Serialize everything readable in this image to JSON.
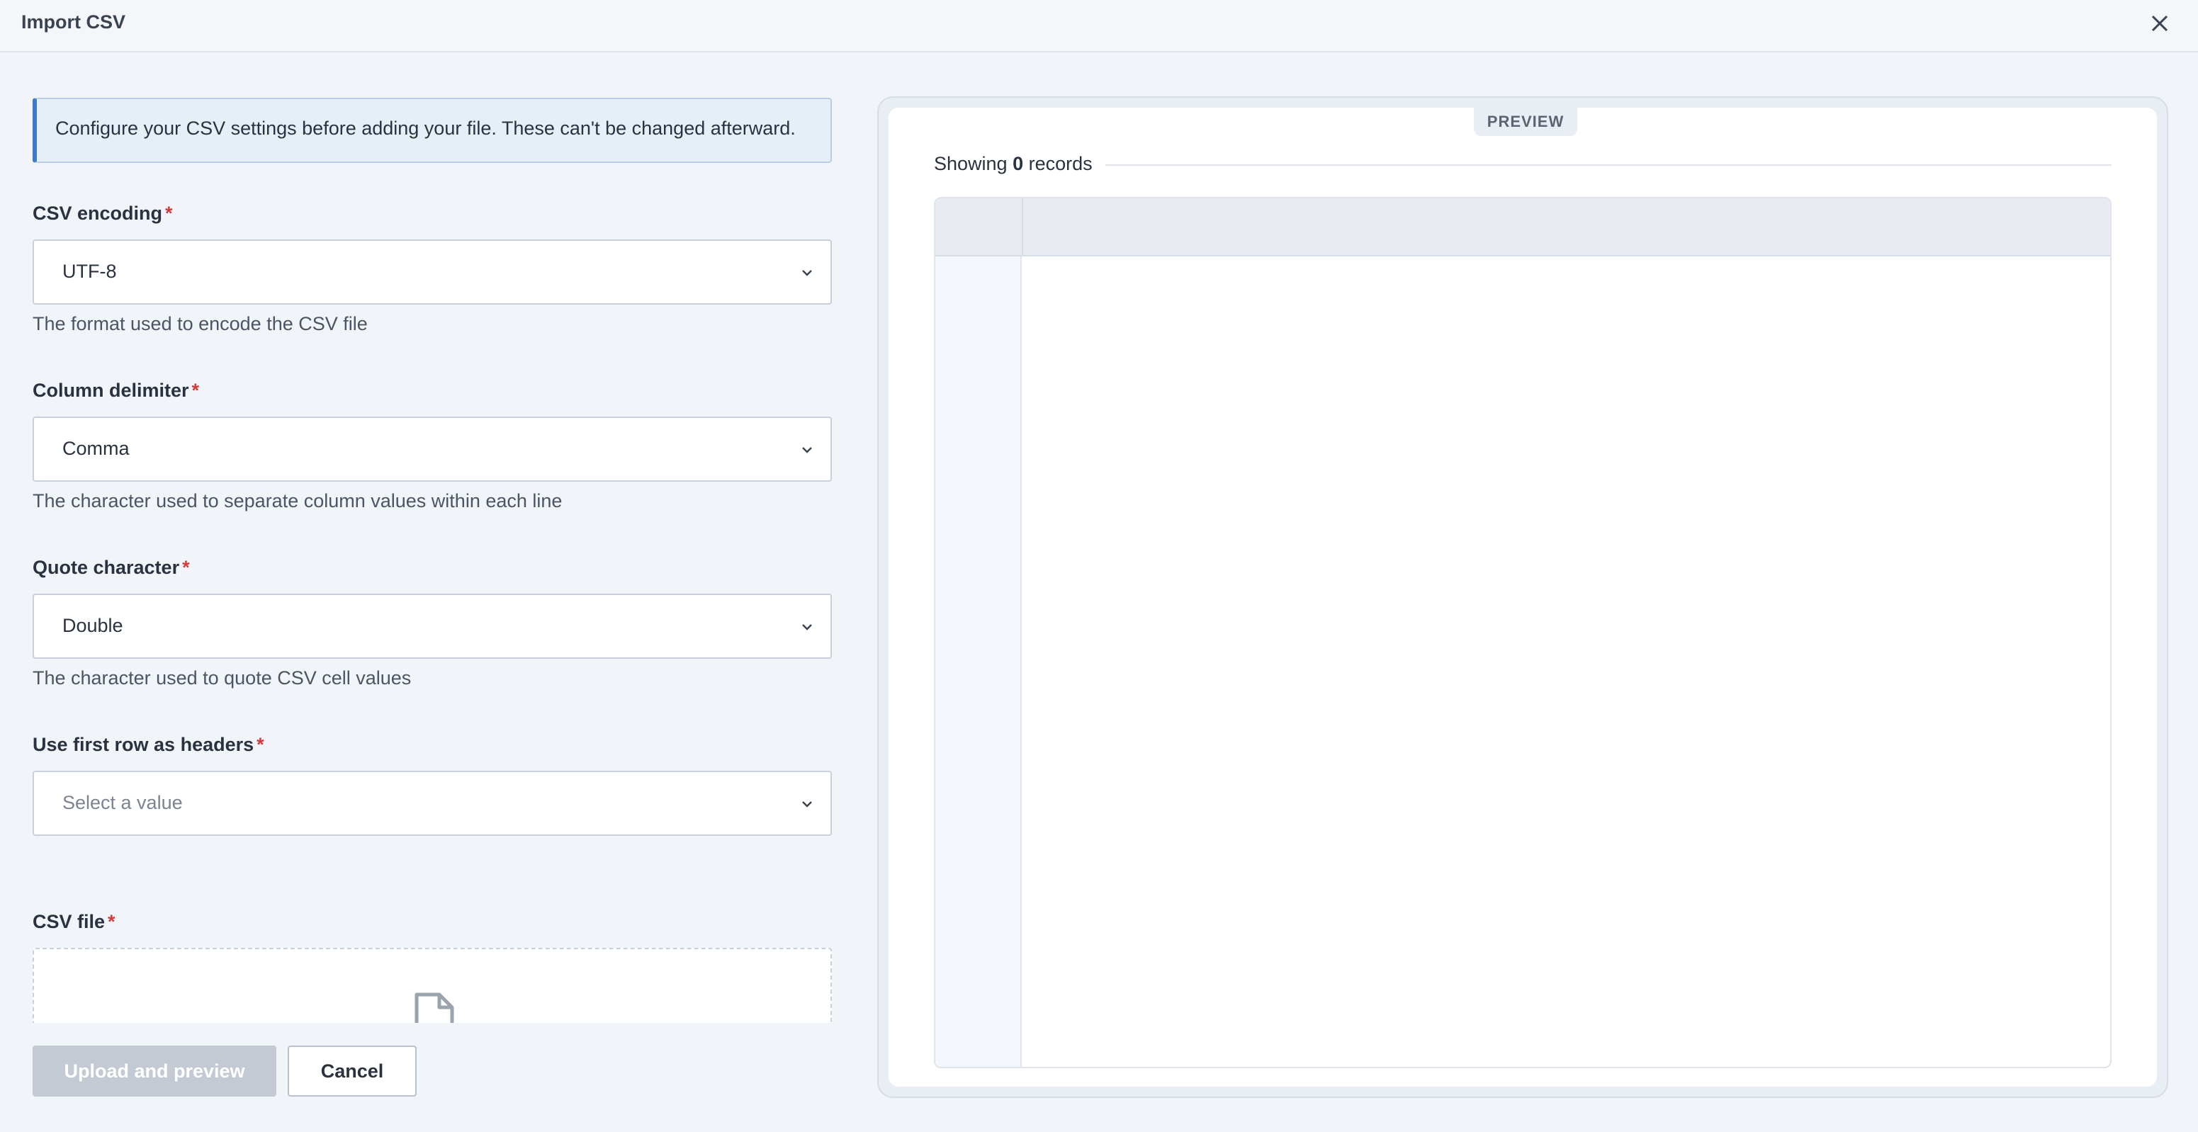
{
  "dialog": {
    "title": "Import CSV",
    "close_icon": "close-icon"
  },
  "notice": {
    "text": "Configure your CSV settings before adding your file. These can't be changed afterward."
  },
  "fields": [
    {
      "label": "CSV encoding",
      "required_mark": "*",
      "value": "UTF-8",
      "help": "The format used to encode the CSV file"
    },
    {
      "label": "Column delimiter",
      "required_mark": "*",
      "value": "Comma",
      "help": "The character used to separate column values within each line"
    },
    {
      "label": "Quote character",
      "required_mark": "*",
      "value": "Double",
      "help": "The character used to quote CSV cell values"
    },
    {
      "label": "Use first row as headers",
      "required_mark": "*",
      "placeholder": "Select a value"
    }
  ],
  "file_field": {
    "label": "CSV file",
    "required_mark": "*",
    "icon": "file-icon"
  },
  "footer": {
    "upload_label": "Upload and preview",
    "cancel_label": "Cancel"
  },
  "preview": {
    "tab_label": "PREVIEW",
    "showing_prefix": "Showing",
    "record_count": "0",
    "showing_suffix": "records"
  },
  "colors": {
    "accent": "#3d7bc4",
    "required": "#d23a3a",
    "disabled_button": "#c3cad4"
  }
}
